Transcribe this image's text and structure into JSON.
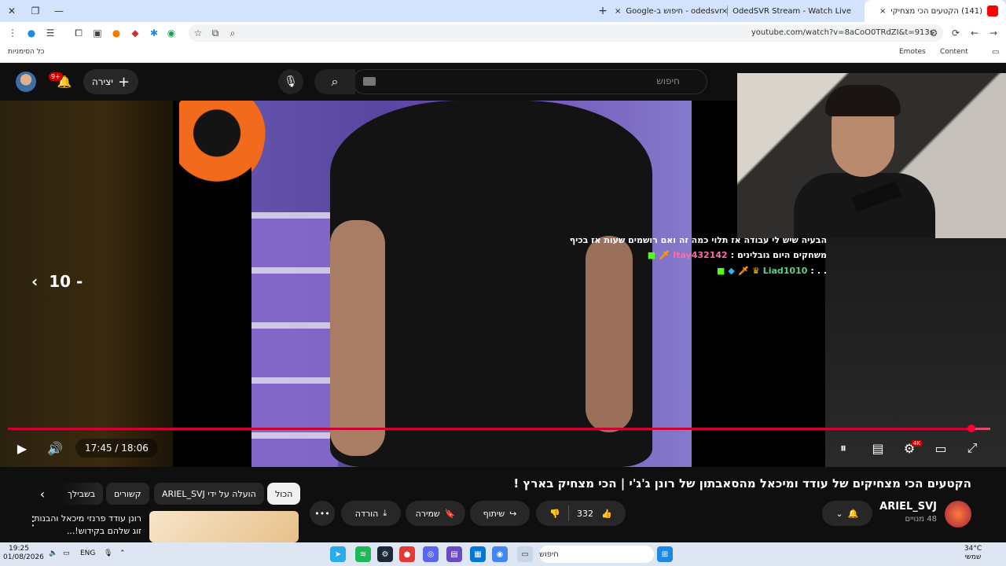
{
  "browser": {
    "tabs": [
      {
        "title": "(141) הקטעים הכי מצחיקי",
        "active": true
      },
      {
        "title": "OdedSVR Stream - Watch Live",
        "active": false
      },
      {
        "title": "odedsvr - חיפוש ב-Google",
        "active": false
      }
    ],
    "url": "youtube.com/watch?v=8aCoO0TRdZI&t=913s",
    "bookmarks": {
      "left_label": "Emotes",
      "content_label": "Content",
      "all_bookmarks": "כל הסימניות"
    },
    "new_tab": "+",
    "close_tab": "×"
  },
  "youtube": {
    "search_placeholder": "חיפוש",
    "create_label": "יצירה",
    "notif_count": "9+",
    "rewind_label": "10 -"
  },
  "stream_overlay": {
    "chat": [
      {
        "user": "",
        "message": "הבעיה שיש לי עבודה אז תלוי כמה זה ואם רושמים שעות אז בכיף"
      },
      {
        "user": "Itay432142",
        "message": "משחקים היום גובלינים"
      },
      {
        "user": "Liad1010",
        "message": ". ."
      }
    ]
  },
  "player": {
    "time": "17:45 / 18:06",
    "progress": 0.98,
    "quality_badge": "4K"
  },
  "video": {
    "title": "הקטעים הכי מצחיקים של עודד ומיכאל מהסאבתון של רונן ג'ג'י | הכי מצחיק בארץ !",
    "channel": "ARIEL_SVJ",
    "subscribers": "48 מנויים",
    "likes": "332",
    "share_label": "שיתוף",
    "save_label": "שמירה",
    "download_label": "הורדה"
  },
  "related": {
    "chips": [
      "הכול",
      "הועלה על ידי ARIEL_SVJ",
      "קשורים",
      "בשבילך"
    ],
    "first_title": "רונן עודד פרנזי מיכאל והבנות זוג שלהם בקידוש!..."
  },
  "taskbar": {
    "search_placeholder": "חיפוש",
    "time": "19:25",
    "date": "01/08/2026",
    "lang": "ENG",
    "weather_temp": "34°C",
    "weather_desc": "שמשי"
  }
}
